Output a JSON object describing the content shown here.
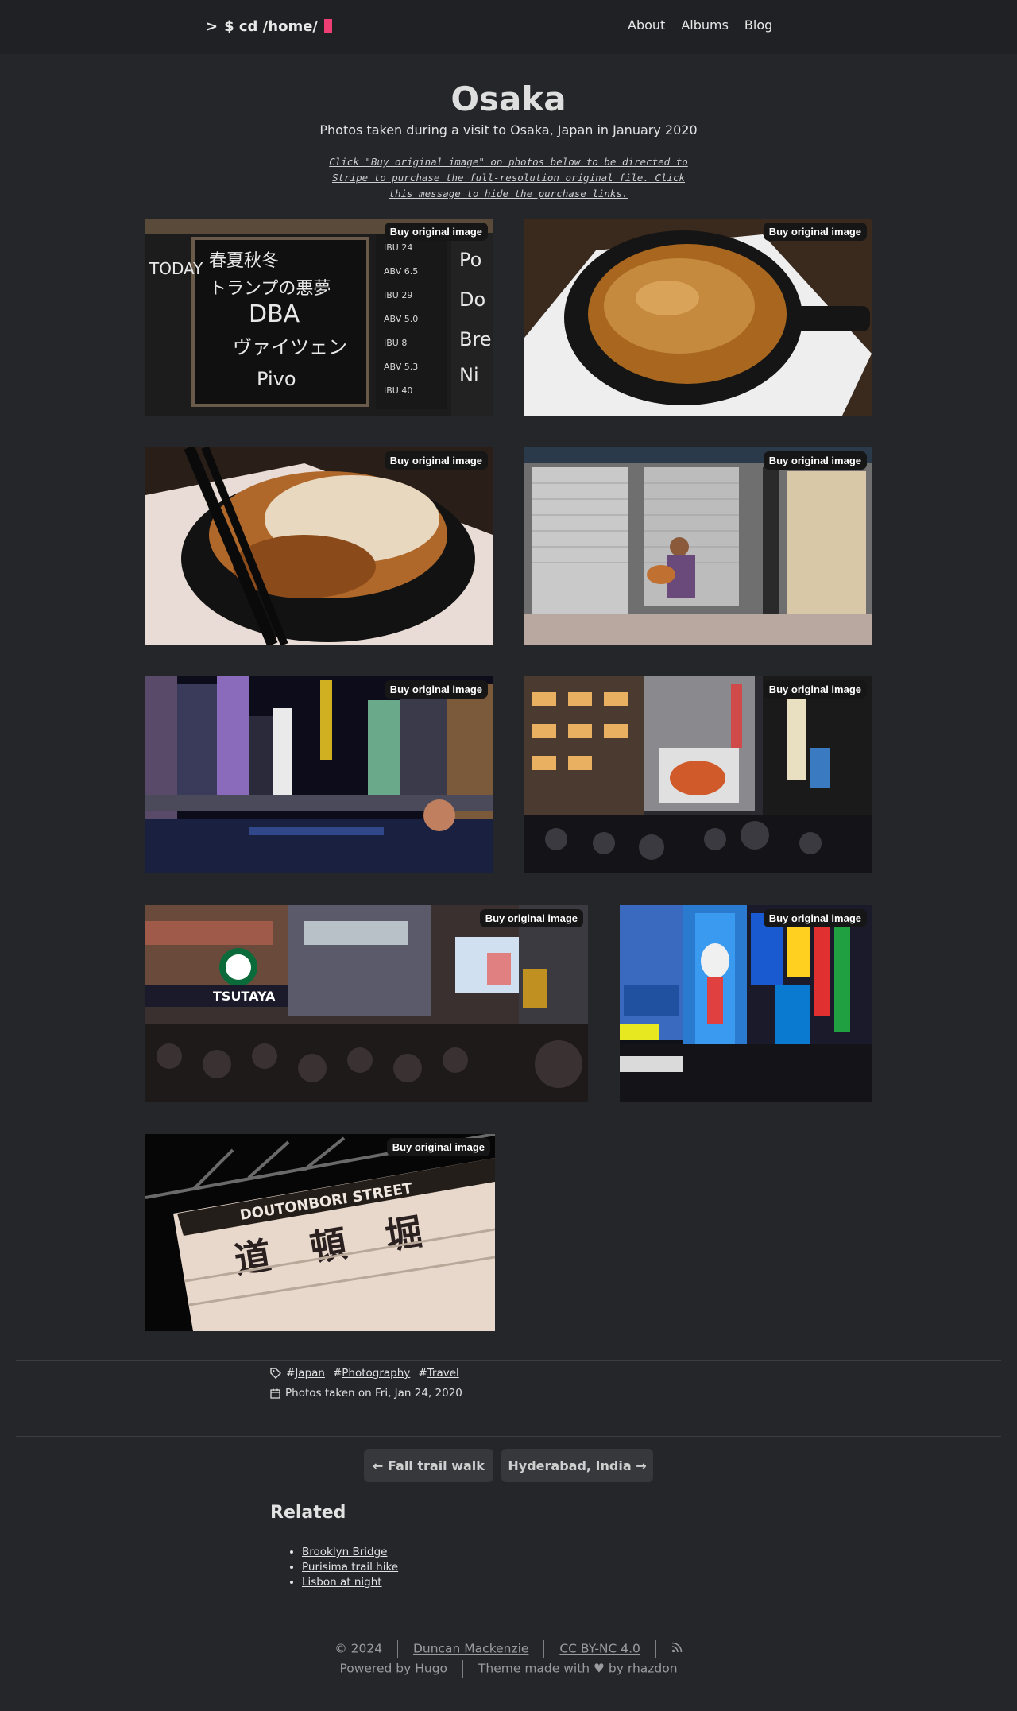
{
  "header": {
    "logo_prompt": ">",
    "logo_text": "$ cd /home/",
    "nav": [
      {
        "label": "About"
      },
      {
        "label": "Albums"
      },
      {
        "label": "Blog"
      }
    ]
  },
  "album": {
    "title": "Osaka",
    "subtitle": "Photos taken during a visit to Osaka, Japan in January 2020",
    "notice": "Click \"Buy original image\" on photos below to be directed to Stripe to purchase the full-resolution original file. Click this message to hide the purchase links.",
    "buy_label": "Buy original image",
    "photos": [
      {
        "name": "photo-beer-menu-board",
        "accent": "#3a3a3a"
      },
      {
        "name": "photo-gyoza-skillet",
        "accent": "#a86a2a"
      },
      {
        "name": "photo-gyoza-chopsticks",
        "accent": "#c49060"
      },
      {
        "name": "photo-street-guitarist",
        "accent": "#9a9a9a"
      },
      {
        "name": "photo-dotonbori-canal-night",
        "accent": "#4a3a7a"
      },
      {
        "name": "photo-crab-sign-street",
        "accent": "#6a4a3a"
      },
      {
        "name": "photo-shopping-arcade-crowd",
        "accent": "#5a5a5a"
      },
      {
        "name": "photo-glico-running-man",
        "accent": "#2a5aaa"
      },
      {
        "name": "photo-doutonbori-street-sign",
        "accent": "#e8d8c8"
      }
    ]
  },
  "meta": {
    "tags": [
      "Japan",
      "Photography",
      "Travel"
    ],
    "date_text": "Photos taken on Fri, Jan 24, 2020"
  },
  "pager": {
    "prev": "← Fall trail walk",
    "next": "Hyderabad, India →"
  },
  "related": {
    "title": "Related",
    "items": [
      "Brooklyn Bridge",
      "Purisima trail hike",
      "Lisbon at night"
    ]
  },
  "footer": {
    "copyright": "© 2024",
    "author": "Duncan Mackenzie",
    "license": "CC BY-NC 4.0",
    "powered_by": "Powered by",
    "hugo": "Hugo",
    "theme": "Theme",
    "made_with": "made with",
    "by": "by",
    "theme_author": "rhazdon"
  },
  "colors": {
    "background": "#25262a",
    "header": "#202124",
    "cursor_accent": "#ee3f74",
    "badge": "#161616"
  }
}
